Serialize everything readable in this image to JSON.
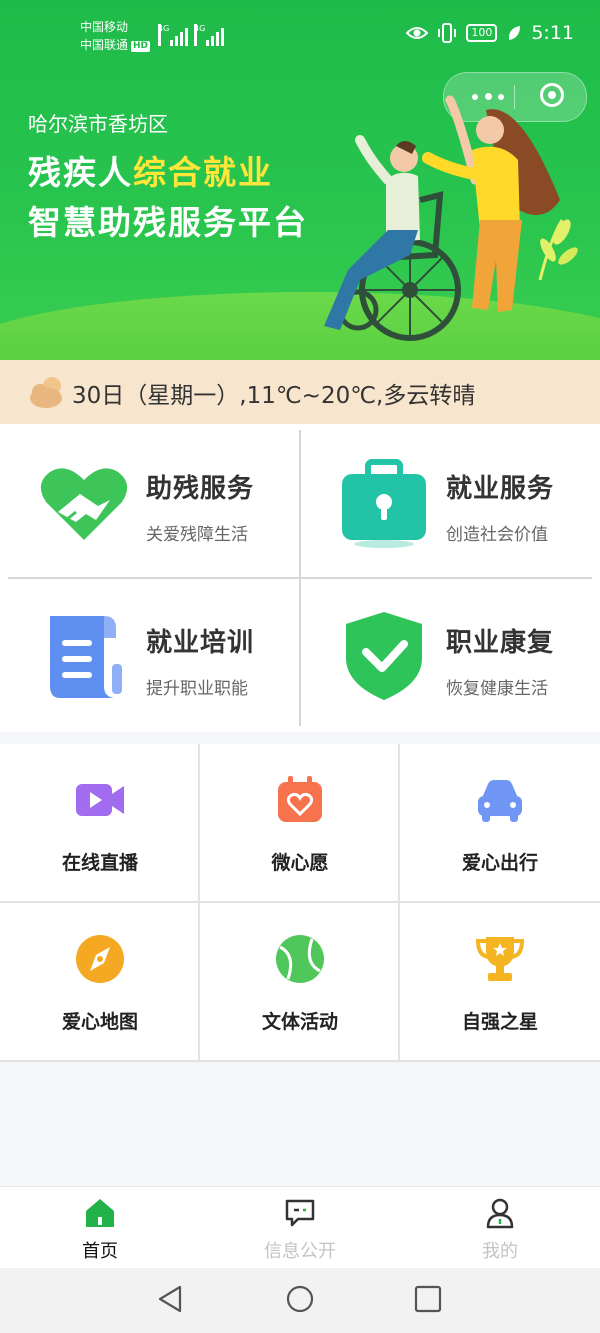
{
  "status_bar": {
    "carrier_1": "中国移动",
    "carrier_2": "中国联通",
    "hd": "HD",
    "network_1": "4G",
    "network_2": "4G",
    "battery": "100",
    "time": "5:11",
    "icons": [
      "eye-icon",
      "vibrate-icon",
      "battery-icon",
      "leaf-icon"
    ]
  },
  "banner": {
    "district": "哈尔滨市香坊区",
    "headline_prefix": "残疾人",
    "headline_highlight": "综合就业",
    "headline_line2": "智慧助残服务平台",
    "colors": {
      "background": "#27c44e",
      "highlight": "#ffe63a"
    }
  },
  "weather": {
    "icon": "cloud-sun-icon",
    "text": "30日（星期一）,11℃~20℃,多云转晴"
  },
  "main_services": [
    {
      "title": "助残服务",
      "subtitle": "关爱残障生活",
      "icon": "handshake-heart-icon",
      "color": "#3dc55a"
    },
    {
      "title": "就业服务",
      "subtitle": "创造社会价值",
      "icon": "briefcase-icon",
      "color": "#22c3a6"
    },
    {
      "title": "就业培训",
      "subtitle": "提升职业职能",
      "icon": "document-icon",
      "color": "#5f8ff0"
    },
    {
      "title": "职业康复",
      "subtitle": "恢复健康生活",
      "icon": "shield-check-icon",
      "color": "#2ec45a"
    }
  ],
  "grid_services": [
    {
      "label": "在线直播",
      "icon": "video-camera-icon",
      "color": "#a26cf0"
    },
    {
      "label": "微心愿",
      "icon": "calendar-heart-icon",
      "color": "#f6734e"
    },
    {
      "label": "爱心出行",
      "icon": "car-icon",
      "color": "#6f95f5"
    },
    {
      "label": "爱心地图",
      "icon": "compass-icon",
      "color": "#f5a822"
    },
    {
      "label": "文体活动",
      "icon": "tennis-ball-icon",
      "color": "#4fc75a"
    },
    {
      "label": "自强之星",
      "icon": "trophy-icon",
      "color": "#f5b421"
    }
  ],
  "tab_bar": [
    {
      "label": "首页",
      "icon": "home-icon",
      "active": true
    },
    {
      "label": "信息公开",
      "icon": "message-icon",
      "active": false
    },
    {
      "label": "我的",
      "icon": "user-icon",
      "active": false
    }
  ],
  "nav_bar": {
    "icons": [
      "back-icon",
      "home-circle-icon",
      "recents-icon"
    ]
  }
}
